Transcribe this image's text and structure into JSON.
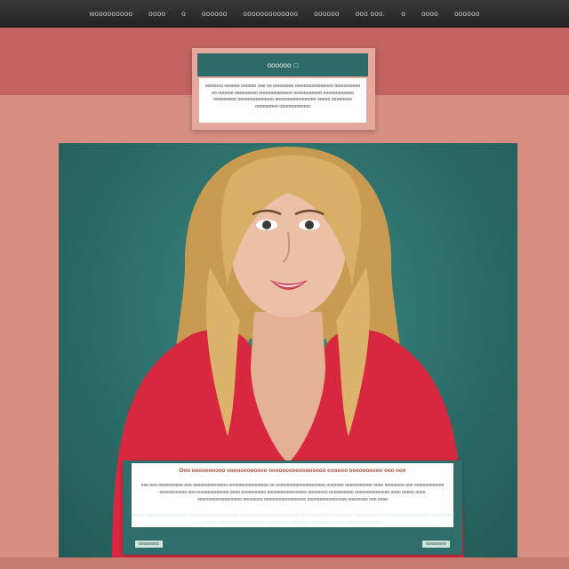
{
  "nav": {
    "items": [
      "wooooooooo",
      "oooo",
      "o",
      "oooooo",
      "ooooooooooooo",
      "oooooo",
      "ooo ooo.",
      "o",
      "oooo",
      "oooooo"
    ]
  },
  "intro": {
    "title": "oooooo",
    "title_icon": "square-icon",
    "body": "ooooooo oooooo oooooo ooo oo oooooooo ooooooooooooooo oooooooooo oo oooooo ooooooooo ooooooooooooo ooooooooooo oooooooooooo ooooooooo oooooooooooooo oooooooooooooooo ooooo oooooooo ooooooooo oooooooooooo"
  },
  "caption": {
    "headline": "Ooo oooooooooo oooooooooooo ooooooooooooooooo oooooo oooooooooo ooo ooo",
    "body1": "ooo ooo oooooooooo ooo oooooooooooooo oooooooooooooooo oo oooooooooooooooooooo ooooooo ooooooooooo oooo oooooooo ooo oooooooooooo ooooooooooo ooo ooooooooooooo oooo oooooooooo oooooooooooooooo oooooooo oooooooooo oooooooooooooo oooo ooooo oooo oooooooooooooooooo oooooooo ooooooooooooooooo oooooooooooooooo oooooooo ooo oooo",
    "body2": "ooooo oooo oooooooooooo ooooooooooooooooooo ooooooooooooooooooooooo oooo ooooo ooo ooooooo ooooooo oooo oooooooooooooooooo oooooooo ooooo oooooooooooooooooo ooooooooo oooooooo ooooooo ooooo oooooooooooooo",
    "tag_left": "oooooooo",
    "tag_right": "oooooooo"
  },
  "colors": {
    "page_bg": "#d68f80",
    "band": "#c26462",
    "teal": "#2f6a6a",
    "shirt": "#d8283f",
    "hair": "#d4a860"
  }
}
